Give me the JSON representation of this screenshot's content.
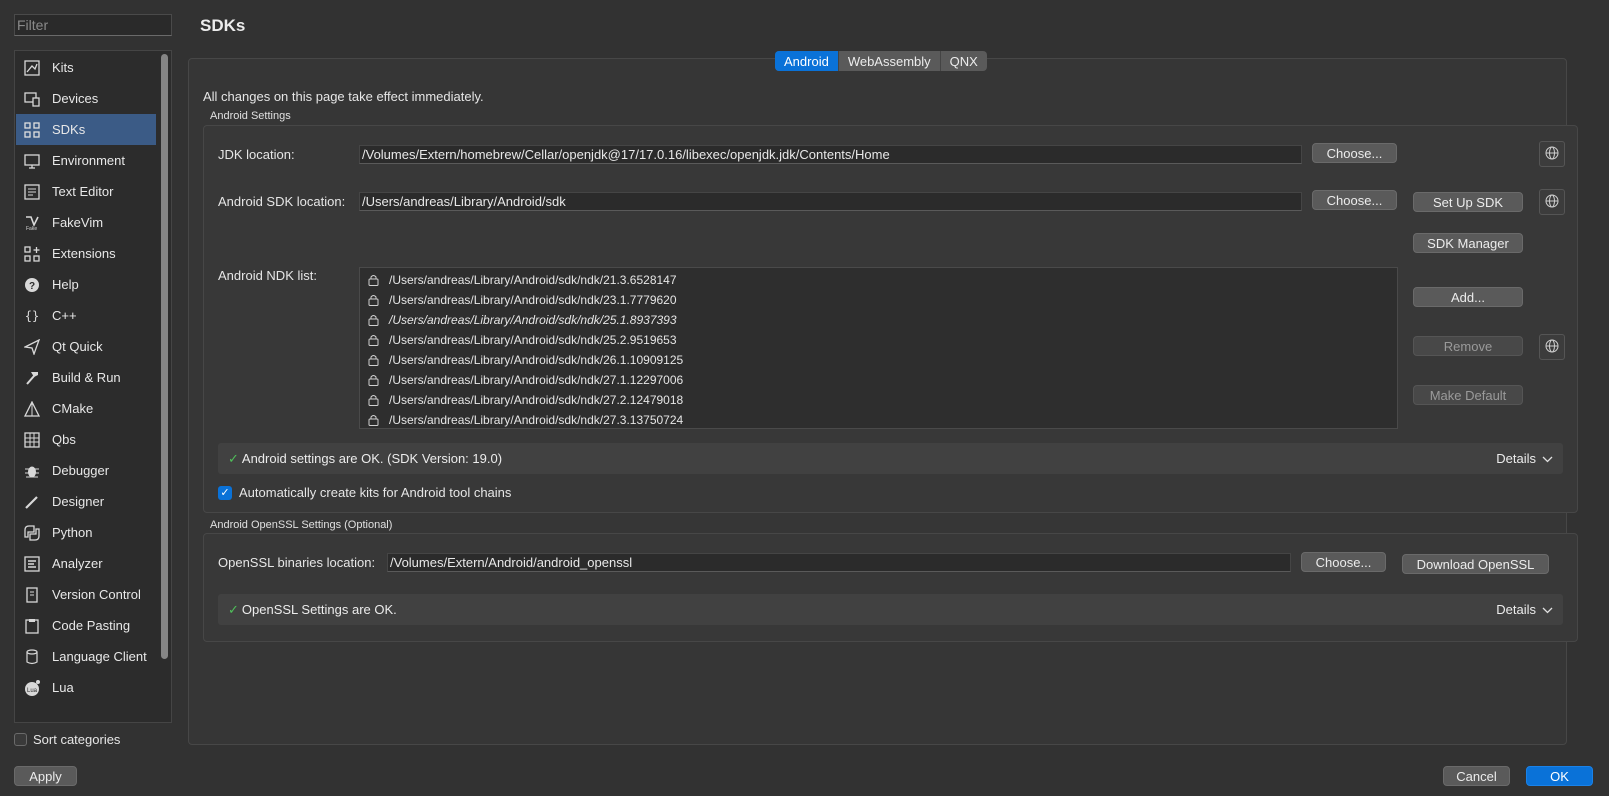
{
  "filter": {
    "placeholder": "Filter"
  },
  "page_title": "SDKs",
  "sidebar": {
    "items": [
      {
        "label": "Kits",
        "icon": "kits-icon"
      },
      {
        "label": "Devices",
        "icon": "devices-icon"
      },
      {
        "label": "SDKs",
        "icon": "sdks-icon",
        "active": true
      },
      {
        "label": "Environment",
        "icon": "environment-icon"
      },
      {
        "label": "Text Editor",
        "icon": "text-editor-icon"
      },
      {
        "label": "FakeVim",
        "icon": "fakevim-icon"
      },
      {
        "label": "Extensions",
        "icon": "extensions-icon"
      },
      {
        "label": "Help",
        "icon": "help-icon"
      },
      {
        "label": "C++",
        "icon": "cpp-icon"
      },
      {
        "label": "Qt Quick",
        "icon": "qt-quick-icon"
      },
      {
        "label": "Build & Run",
        "icon": "build-run-icon"
      },
      {
        "label": "CMake",
        "icon": "cmake-icon"
      },
      {
        "label": "Qbs",
        "icon": "qbs-icon"
      },
      {
        "label": "Debugger",
        "icon": "debugger-icon"
      },
      {
        "label": "Designer",
        "icon": "designer-icon"
      },
      {
        "label": "Python",
        "icon": "python-icon"
      },
      {
        "label": "Analyzer",
        "icon": "analyzer-icon"
      },
      {
        "label": "Version Control",
        "icon": "version-control-icon"
      },
      {
        "label": "Code Pasting",
        "icon": "code-pasting-icon"
      },
      {
        "label": "Language Client",
        "icon": "language-client-icon"
      },
      {
        "label": "Lua",
        "icon": "lua-icon"
      }
    ],
    "sort_label": "Sort categories"
  },
  "tabs": [
    "Android",
    "WebAssembly",
    "QNX"
  ],
  "info_text": "All changes on this page take effect immediately.",
  "android_settings": {
    "group_title": "Android Settings",
    "jdk_label": "JDK location:",
    "jdk_value": "/Volumes/Extern/homebrew/Cellar/openjdk@17/17.0.16/libexec/openjdk.jdk/Contents/Home",
    "sdk_label": "Android SDK location:",
    "sdk_value": "/Users/andreas/Library/Android/sdk",
    "choose_label": "Choose...",
    "setup_sdk_label": "Set Up SDK",
    "sdk_manager_label": "SDK Manager",
    "ndk_label": "Android NDK list:",
    "ndk_list": [
      "/Users/andreas/Library/Android/sdk/ndk/21.3.6528147",
      "/Users/andreas/Library/Android/sdk/ndk/23.1.7779620",
      "/Users/andreas/Library/Android/sdk/ndk/25.1.8937393",
      "/Users/andreas/Library/Android/sdk/ndk/25.2.9519653",
      "/Users/andreas/Library/Android/sdk/ndk/26.1.10909125",
      "/Users/andreas/Library/Android/sdk/ndk/27.1.12297006",
      "/Users/andreas/Library/Android/sdk/ndk/27.2.12479018",
      "/Users/andreas/Library/Android/sdk/ndk/27.3.13750724"
    ],
    "add_label": "Add...",
    "remove_label": "Remove",
    "make_default_label": "Make Default",
    "status_text": "Android settings are OK. (SDK Version: 19.0)",
    "details_label": "Details",
    "auto_kits_label": "Automatically create kits for Android tool chains"
  },
  "openssl": {
    "group_title": "Android OpenSSL Settings (Optional)",
    "location_label": "OpenSSL binaries location:",
    "location_value": "/Volumes/Extern/Android/android_openssl",
    "choose_label": "Choose...",
    "download_label": "Download OpenSSL",
    "status_text": "OpenSSL Settings are OK.",
    "details_label": "Details"
  },
  "footer": {
    "apply_label": "Apply",
    "cancel_label": "Cancel",
    "ok_label": "OK"
  },
  "colors": {
    "accent": "#0a72d8",
    "selection": "#3b5b86",
    "ok_check": "#4fbf5a"
  }
}
